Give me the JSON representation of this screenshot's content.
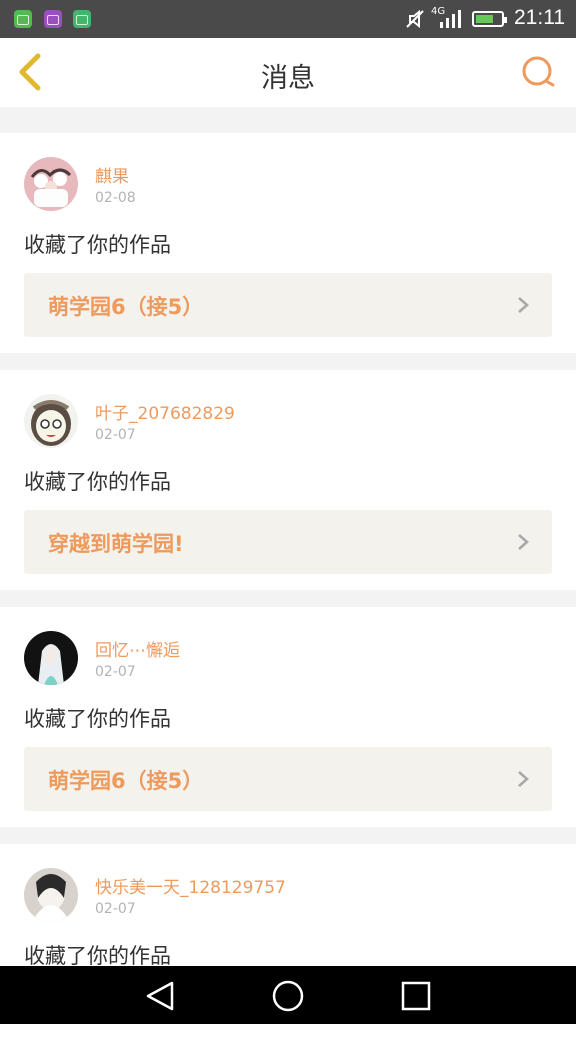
{
  "status_bar": {
    "time": "21:11",
    "network": "4G",
    "icons": [
      "app-icon",
      "gallery-icon",
      "app-icon",
      "mute-icon",
      "signal-icon",
      "battery-charging-icon"
    ]
  },
  "header": {
    "title": "消息",
    "back_icon": "chevron-left-icon",
    "search_icon": "search-icon"
  },
  "notifications": [
    {
      "username": "麒果",
      "date": "02-08",
      "action": "收藏了你的作品",
      "work": "萌学园6（接5）"
    },
    {
      "username": "叶子_207682829",
      "date": "02-07",
      "action": "收藏了你的作品",
      "work": "穿越到萌学园!"
    },
    {
      "username": "回忆⋯懈逅",
      "date": "02-07",
      "action": "收藏了你的作品",
      "work": "萌学园6（接5）"
    },
    {
      "username": "快乐美一天_128129757",
      "date": "02-07",
      "action": "收藏了你的作品",
      "work": ""
    }
  ],
  "colors": {
    "accent": "#ef9a5d",
    "card_bg": "#ffffff",
    "work_bg": "#f3f2ec",
    "status_bar": "#4a4a4a"
  },
  "nav_bar": {
    "icons": [
      "back-triangle-icon",
      "home-circle-icon",
      "recent-square-icon"
    ]
  }
}
